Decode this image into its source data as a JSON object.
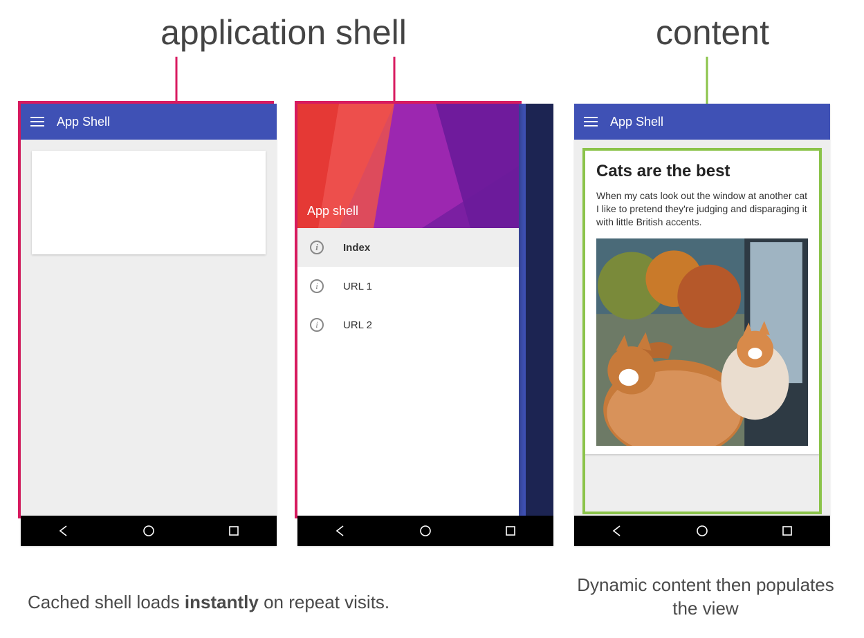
{
  "labels": {
    "application_shell": "application shell",
    "content": "content"
  },
  "colors": {
    "highlight_pink": "#d81b60",
    "highlight_green": "#8bc34a",
    "appbar": "#3f51b5"
  },
  "phone1": {
    "appbar_title": "App Shell"
  },
  "phone2": {
    "drawer_header_title": "App shell",
    "drawer_items": [
      {
        "label": "Index",
        "active": true
      },
      {
        "label": "URL 1",
        "active": false
      },
      {
        "label": "URL 2",
        "active": false
      }
    ]
  },
  "phone3": {
    "appbar_title": "App Shell",
    "card_title": "Cats are the best",
    "card_body": "When my cats look out the window at another cat I like to pretend they're judging and disparaging it with little British accents."
  },
  "captions": {
    "left_prefix": "Cached shell loads ",
    "left_bold": "instantly",
    "left_suffix": " on repeat visits.",
    "right": "Dynamic content then populates the view"
  }
}
